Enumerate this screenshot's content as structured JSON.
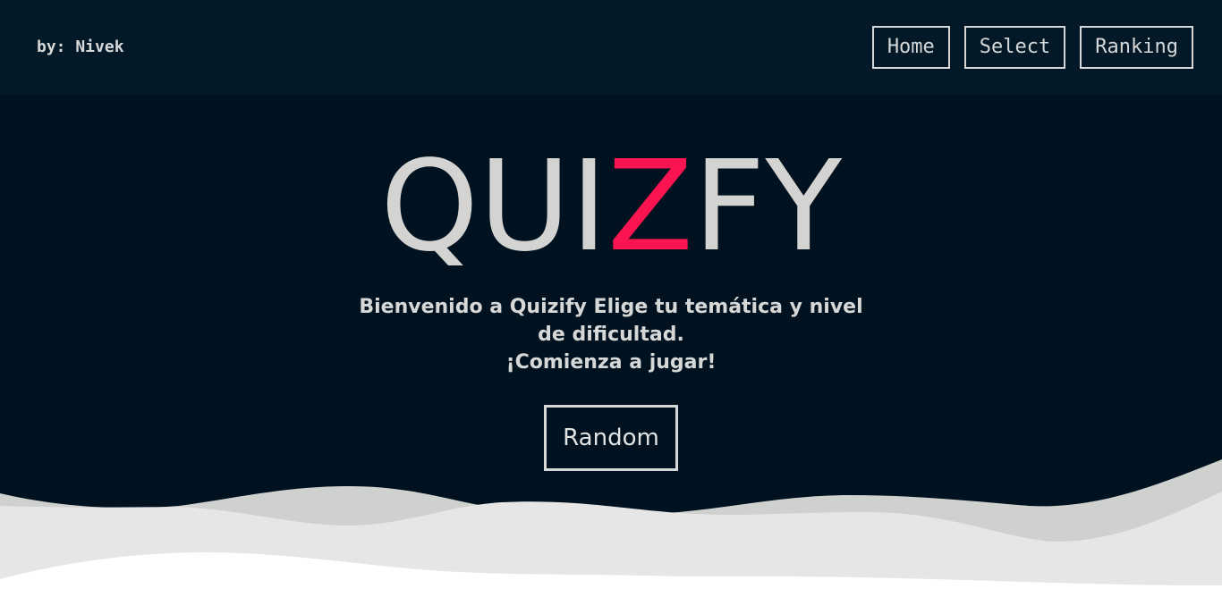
{
  "header": {
    "byline": "by: Nivek",
    "nav": [
      {
        "label": "Home"
      },
      {
        "label": "Select"
      },
      {
        "label": "Ranking"
      }
    ]
  },
  "hero": {
    "logo_part1": "QUI",
    "logo_accent": "Z",
    "logo_part2": "FY",
    "welcome_line1": "Bienvenido a Quizify Elige tu temática y nivel",
    "welcome_line2": "de dificultad.",
    "welcome_line3": "¡Comienza a jugar!",
    "random_label": "Random"
  },
  "colors": {
    "background": "#001220",
    "header_bg": "#031927",
    "accent": "#fa1450",
    "text": "#d6d8d8",
    "wave_back": "#cfd1ce",
    "wave_mid": "#e6e6e6",
    "wave_front": "#ffffff"
  }
}
